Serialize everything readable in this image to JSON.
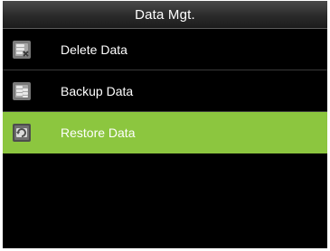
{
  "header": {
    "title": "Data Mgt."
  },
  "menu": {
    "items": [
      {
        "label": "Delete Data",
        "icon": "delete-data-icon",
        "selected": false
      },
      {
        "label": "Backup Data",
        "icon": "backup-data-icon",
        "selected": false
      },
      {
        "label": "Restore Data",
        "icon": "restore-data-icon",
        "selected": true
      }
    ]
  },
  "colors": {
    "background": "#000000",
    "selected": "#8cc63f",
    "text": "#ffffff"
  }
}
